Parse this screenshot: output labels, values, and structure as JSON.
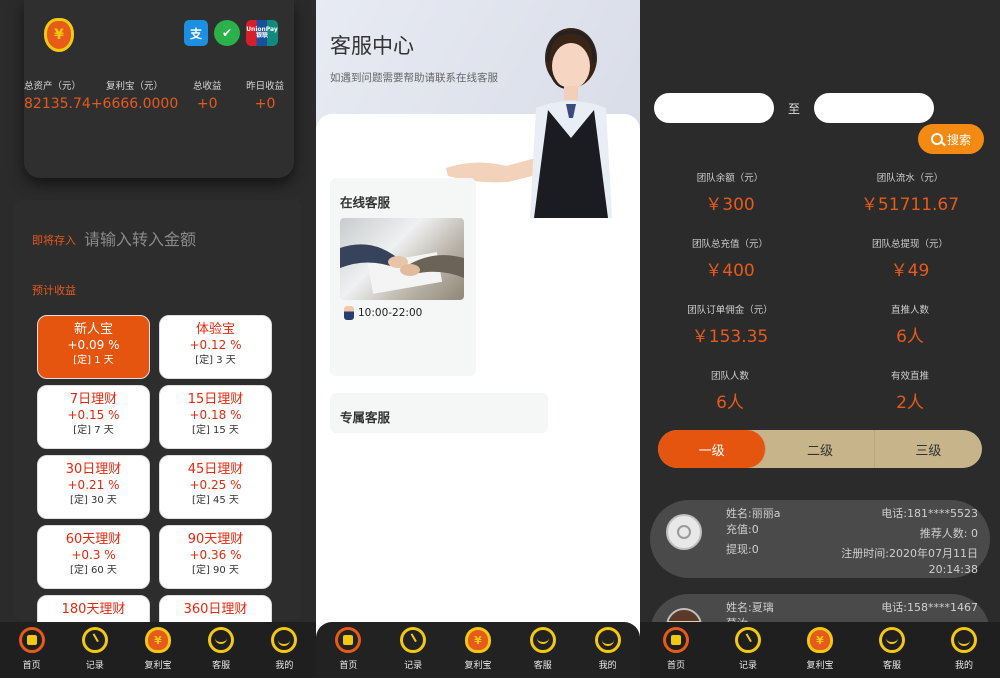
{
  "panel1": {
    "logo_symbol": "¥",
    "pay_icons": [
      {
        "name": "alipay-icon",
        "glyph": "支"
      },
      {
        "name": "wechat-pay-icon",
        "glyph": "✔"
      },
      {
        "name": "unionpay-icon",
        "glyph": "UnionPay 银联"
      }
    ],
    "stats": [
      {
        "label": "总资产（元）",
        "value": "82135.74"
      },
      {
        "label": "复利宝（元）",
        "value": "+6666.0000"
      },
      {
        "label": "总收益",
        "value": "+0"
      },
      {
        "label": "昨日收益",
        "value": "+0"
      }
    ],
    "deposit_label": "即将存入",
    "deposit_placeholder": "请输入转入金额",
    "expected_label": "预计收益",
    "products": [
      {
        "name": "新人宝",
        "rate": "+0.09 %",
        "term": "[定] 1 天",
        "active": true
      },
      {
        "name": "体验宝",
        "rate": "+0.12 %",
        "term": "[定] 3 天"
      },
      {
        "name": "7日理财",
        "rate": "+0.15 %",
        "term": "[定] 7 天"
      },
      {
        "name": "15日理财",
        "rate": "+0.18 %",
        "term": "[定] 15 天"
      },
      {
        "name": "30日理财",
        "rate": "+0.21 %",
        "term": "[定] 30 天"
      },
      {
        "name": "45日理财",
        "rate": "+0.25 %",
        "term": "[定] 45 天"
      },
      {
        "name": "60天理财",
        "rate": "+0.3 %",
        "term": "[定] 60 天"
      },
      {
        "name": "90天理财",
        "rate": "+0.36 %",
        "term": "[定] 90 天"
      },
      {
        "name": "180天理财",
        "rate": "",
        "term": ""
      },
      {
        "name": "360日理财",
        "rate": "",
        "term": ""
      }
    ]
  },
  "panel2": {
    "title": "客服中心",
    "subtitle": "如遇到问题需要帮助请联系在线客服",
    "online_title": "在线客服",
    "hours": "10:00-22:00",
    "exclusive_title": "专属客服"
  },
  "panel3": {
    "date_separator": "至",
    "search_label": "搜索",
    "team_stats": [
      {
        "label": "团队余额（元）",
        "value": "￥300"
      },
      {
        "label": "团队流水（元）",
        "value": "￥51711.67"
      },
      {
        "label": "团队总充值（元）",
        "value": "￥400"
      },
      {
        "label": "团队总提现（元）",
        "value": "￥49"
      },
      {
        "label": "团队订单佣金（元）",
        "value": "￥153.35"
      },
      {
        "label": "直推人数",
        "value": "6人"
      },
      {
        "label": "团队人数",
        "value": "6人"
      },
      {
        "label": "有效直推",
        "value": "2人"
      }
    ],
    "tabs": [
      "一级",
      "二级",
      "三级"
    ],
    "members": [
      {
        "name": "姓名:丽丽a",
        "recharge": "充值:0",
        "withdraw": "提现:0",
        "phone": "电话:181****5523",
        "referrals": "推荐人数: 0",
        "reg_date": "注册时间:2020年07月11日",
        "reg_time": "20:14:38"
      },
      {
        "name": "姓名:夏璃莫汝",
        "recharge": "",
        "withdraw": "",
        "phone": "电话:158****1467",
        "referrals": "",
        "reg_date": "",
        "reg_time": ""
      }
    ]
  },
  "nav": [
    {
      "label": "首页",
      "icon": "home"
    },
    {
      "label": "记录",
      "icon": "clock"
    },
    {
      "label": "复利宝",
      "icon": "bag"
    },
    {
      "label": "客服",
      "icon": "chat"
    },
    {
      "label": "我的",
      "icon": "smile"
    }
  ],
  "colors": {
    "accent": "#e65a1a",
    "gold": "#f2c811",
    "tab_bg": "#c8b48a"
  }
}
